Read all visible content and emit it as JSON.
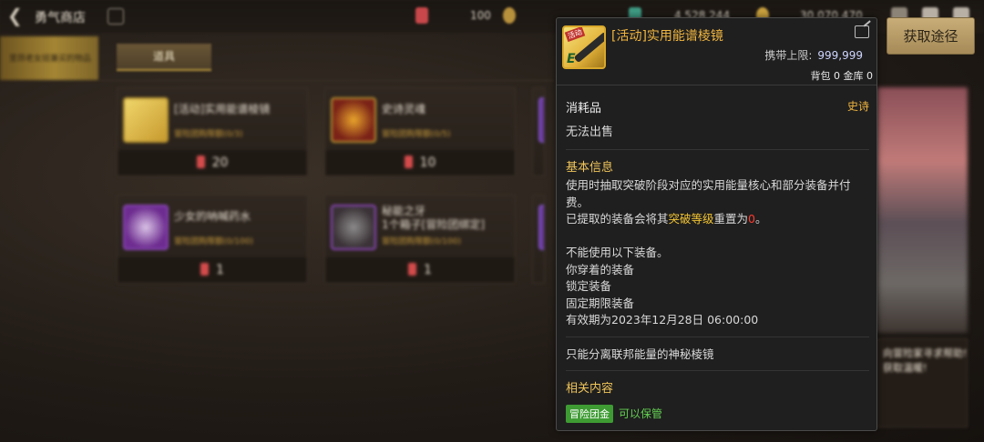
{
  "header": {
    "shop_title": "勇气商店",
    "currency_1": "100",
    "currency_2": "4,528,244",
    "currency_3": "30,070,470"
  },
  "nav": {
    "left_tab": "里昂老女班兼买的物品",
    "tab_items": "道具"
  },
  "cards": [
    {
      "name": "[活动]实用能谱棱镜",
      "limit": "冒险团购限额(0/3)",
      "price": "20"
    },
    {
      "name": "史诗灵魂",
      "limit": "冒险团购限额(0/5)",
      "price": "10"
    },
    {
      "name": "少女的呐喊药水",
      "limit": "冒险团购限额(0/100)",
      "price": "1"
    },
    {
      "name": "秘能之牙\n1个箱子[冒险团绑定]",
      "limit": "冒险团购限额(0/100)",
      "price": "1"
    }
  ],
  "promo": {
    "text": "向冒险家寻求帮助!\n获取温暖!"
  },
  "tooltip": {
    "item_name": "[活动]实用能谱棱镜",
    "icon_tag": "活动",
    "icon_grade": "E",
    "carry_label": "携带上限:",
    "carry_value": "999,999",
    "storage": "背包 0 金库 0",
    "category": "消耗品",
    "rarity": "史诗",
    "no_sell": "无法出售",
    "basic_info_title": "基本信息",
    "desc_1": "使用时抽取突破阶段对应的实用能量核心和部分装备并付费。",
    "desc_2_pre": "已提取的装备会将其",
    "desc_2_hl": "突破等级",
    "desc_2_mid": "重置为",
    "desc_2_red": "0",
    "desc_2_post": "。",
    "cannot_use": "不能使用以下装备。",
    "list_1": "你穿着的装备",
    "list_2": "锁定装备",
    "list_3": "固定期限装备",
    "expire": "有效期为2023年12月28日 06:00:00",
    "note": "只能分离联邦能量的神秘棱镜",
    "related_title": "相关内容",
    "badge": "冒险团金",
    "keepable": "可以保管"
  },
  "get_path_button": "获取途径",
  "colors": {
    "rarity_gold": "#f0b53f",
    "highlight": "#f3c433",
    "warn_red": "#ff3b2f",
    "badge_green": "#3e9b33"
  }
}
